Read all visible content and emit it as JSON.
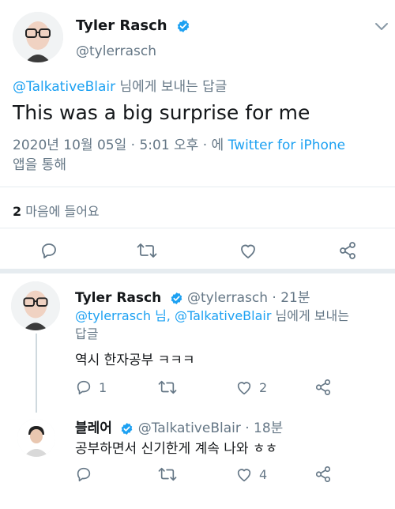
{
  "main_tweet": {
    "display_name": "Tyler Rasch",
    "handle": "@tylerrasch",
    "reply_mention": "@TalkativeBlair",
    "reply_suffix": " 님에게 보내는 답글",
    "text": "This was a big surprise for me",
    "timestamp": "2020년 10월 05일 · 5:01 오후 · 에 ",
    "source": "Twitter for iPhone",
    "source_suffix": "앱을 통해",
    "likes_count": "2",
    "likes_label": " 마음에 들어요"
  },
  "replies": [
    {
      "display_name": "Tyler Rasch",
      "handle_time": "@tylerrasch · 21분",
      "mention_1": "@tylerrasch",
      "mention_sep": " 님, ",
      "mention_2": "@TalkativeBlair",
      "mention_suffix": " 님에게 보내는",
      "mention_line2": "답글",
      "text": "역시 한자공부 ㅋㅋㅋ",
      "reply_count": "1",
      "like_count": "2"
    },
    {
      "display_name": "블레어",
      "handle_time": "@TalkativeBlair · 18분",
      "text": "공부하면서 신기한게 계속 나와 ㅎㅎ",
      "like_count": "4"
    }
  ],
  "icons": {
    "verified": "verified-badge-icon",
    "caret": "chevron-down-icon",
    "reply": "reply-icon",
    "retweet": "retweet-icon",
    "like": "heart-icon",
    "share": "share-icon"
  },
  "colors": {
    "accent": "#1da1f2",
    "secondary_text": "#657786",
    "divider": "#e6ecf0"
  }
}
